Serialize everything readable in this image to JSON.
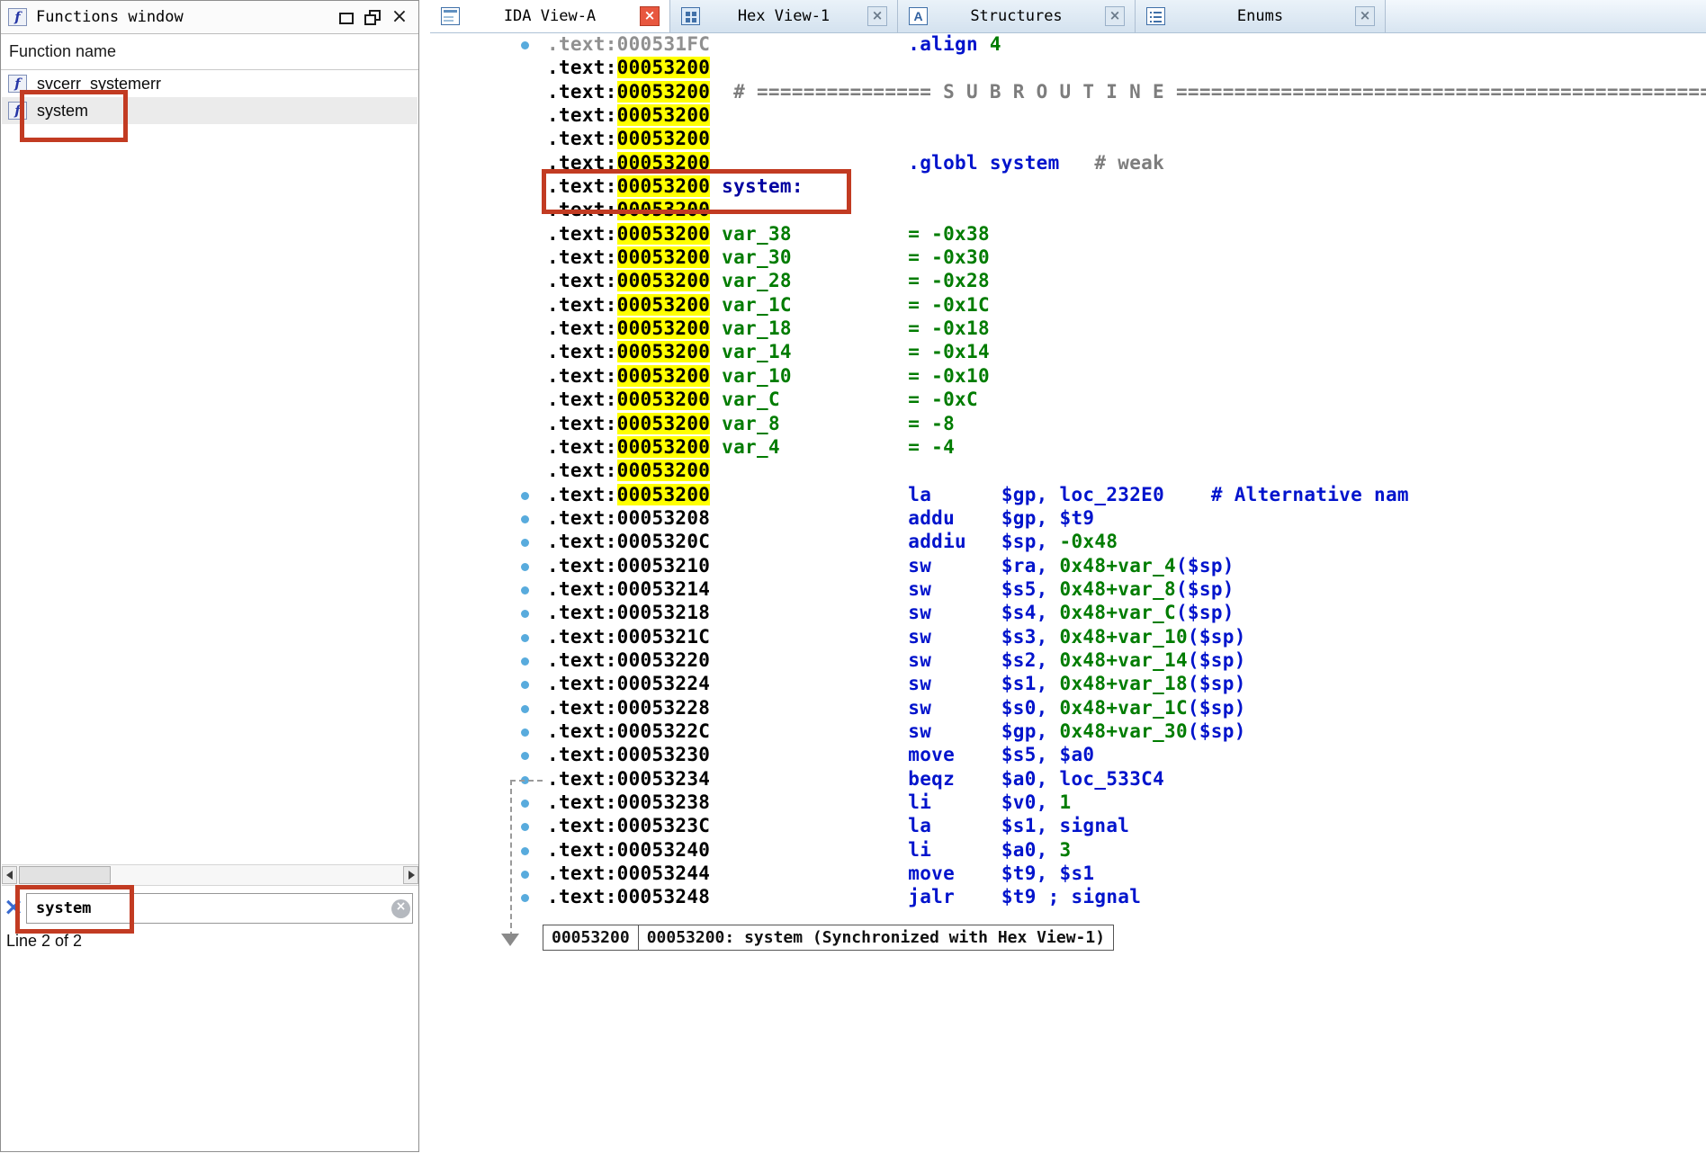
{
  "window": {
    "title": "Functions window"
  },
  "icons": {
    "function_glyph": "f",
    "close_glyph": "×",
    "tab_close_glyph": "×",
    "clear_glyph": "×",
    "filter_glyph": "×"
  },
  "colors": {
    "highlight_yellow": "#ffff00",
    "instruction_blue": "#0013cc",
    "number_green": "#007c00",
    "comment_gray": "#7d7d7d",
    "label_navy": "#0000a0",
    "nav_dot_blue": "#58abdd",
    "annotation_red": "#c23b22",
    "active_close_red": "#e8573f"
  },
  "functions_panel": {
    "column_header": "Function name",
    "rows": [
      {
        "label": "svcerr_systemerr",
        "selected": false
      },
      {
        "label": "system",
        "selected": true
      }
    ],
    "search": {
      "value": "system"
    },
    "status_line": "Line 2 of 2"
  },
  "tab_bar": {
    "tabs": [
      {
        "label": "IDA View-A",
        "icon": "ida-view-icon",
        "active": true
      },
      {
        "label": "Hex View-1",
        "icon": "hex-view-icon",
        "active": false
      },
      {
        "label": "Structures",
        "icon": "structures-icon",
        "active": false
      },
      {
        "label": "Enums",
        "icon": "enums-icon",
        "active": false
      }
    ]
  },
  "disassembly": {
    "status_cells": [
      "00053200",
      "00053200: system (Synchronized with Hex View-1)"
    ],
    "lines": [
      {
        "addr": "000531FC",
        "dim": 1,
        "dot": 1,
        "tokens": [
          [
            "k",
            "                 "
          ],
          [
            "b",
            ".align "
          ],
          [
            "g",
            "4"
          ]
        ]
      },
      {
        "addr": "00053200",
        "hl": 1,
        "tokens": []
      },
      {
        "addr": "00053200",
        "hl": 1,
        "tokens": [
          [
            "c",
            "  # =============== S U B R O U T I N E =============================================================="
          ]
        ]
      },
      {
        "addr": "00053200",
        "hl": 1,
        "tokens": []
      },
      {
        "addr": "00053200",
        "hl": 1,
        "tokens": []
      },
      {
        "addr": "00053200",
        "hl": 1,
        "tokens": [
          [
            "k",
            "                 "
          ],
          [
            "b",
            ".globl system"
          ],
          [
            "k",
            "   "
          ],
          [
            "c",
            "# weak"
          ]
        ]
      },
      {
        "addr": "00053200",
        "hl": 1,
        "tokens": [
          [
            "k",
            " "
          ],
          [
            "nv",
            "system:"
          ]
        ]
      },
      {
        "addr": "00053200",
        "hl": 1,
        "tokens": []
      },
      {
        "addr": "00053200",
        "hl": 1,
        "tokens": [
          [
            "k",
            " "
          ],
          [
            "g",
            "var_38"
          ],
          [
            "k",
            "          "
          ],
          [
            "g",
            "= -0x38"
          ]
        ]
      },
      {
        "addr": "00053200",
        "hl": 1,
        "tokens": [
          [
            "k",
            " "
          ],
          [
            "g",
            "var_30"
          ],
          [
            "k",
            "          "
          ],
          [
            "g",
            "= -0x30"
          ]
        ]
      },
      {
        "addr": "00053200",
        "hl": 1,
        "tokens": [
          [
            "k",
            " "
          ],
          [
            "g",
            "var_28"
          ],
          [
            "k",
            "          "
          ],
          [
            "g",
            "= -0x28"
          ]
        ]
      },
      {
        "addr": "00053200",
        "hl": 1,
        "tokens": [
          [
            "k",
            " "
          ],
          [
            "g",
            "var_1C"
          ],
          [
            "k",
            "          "
          ],
          [
            "g",
            "= -0x1C"
          ]
        ]
      },
      {
        "addr": "00053200",
        "hl": 1,
        "tokens": [
          [
            "k",
            " "
          ],
          [
            "g",
            "var_18"
          ],
          [
            "k",
            "          "
          ],
          [
            "g",
            "= -0x18"
          ]
        ]
      },
      {
        "addr": "00053200",
        "hl": 1,
        "tokens": [
          [
            "k",
            " "
          ],
          [
            "g",
            "var_14"
          ],
          [
            "k",
            "          "
          ],
          [
            "g",
            "= -0x14"
          ]
        ]
      },
      {
        "addr": "00053200",
        "hl": 1,
        "tokens": [
          [
            "k",
            " "
          ],
          [
            "g",
            "var_10"
          ],
          [
            "k",
            "          "
          ],
          [
            "g",
            "= -0x10"
          ]
        ]
      },
      {
        "addr": "00053200",
        "hl": 1,
        "tokens": [
          [
            "k",
            " "
          ],
          [
            "g",
            "var_C"
          ],
          [
            "k",
            "           "
          ],
          [
            "g",
            "= -0xC"
          ]
        ]
      },
      {
        "addr": "00053200",
        "hl": 1,
        "tokens": [
          [
            "k",
            " "
          ],
          [
            "g",
            "var_8"
          ],
          [
            "k",
            "           "
          ],
          [
            "g",
            "= -8"
          ]
        ]
      },
      {
        "addr": "00053200",
        "hl": 1,
        "tokens": [
          [
            "k",
            " "
          ],
          [
            "g",
            "var_4"
          ],
          [
            "k",
            "           "
          ],
          [
            "g",
            "= -4"
          ]
        ]
      },
      {
        "addr": "00053200",
        "hl": 1,
        "tokens": []
      },
      {
        "addr": "00053200",
        "hl": 1,
        "dot": 1,
        "tokens": [
          [
            "k",
            "                 "
          ],
          [
            "b",
            "la"
          ],
          [
            "k",
            "      "
          ],
          [
            "b",
            "$gp, loc_232E0"
          ],
          [
            "k",
            "    "
          ],
          [
            "b",
            "# Alternative nam"
          ]
        ]
      },
      {
        "addr": "00053208",
        "dot": 1,
        "tokens": [
          [
            "k",
            "                 "
          ],
          [
            "b",
            "addu"
          ],
          [
            "k",
            "    "
          ],
          [
            "b",
            "$gp, $t9"
          ]
        ]
      },
      {
        "addr": "0005320C",
        "dot": 1,
        "tokens": [
          [
            "k",
            "                 "
          ],
          [
            "b",
            "addiu"
          ],
          [
            "k",
            "   "
          ],
          [
            "b",
            "$sp, "
          ],
          [
            "g",
            "-0x48"
          ]
        ]
      },
      {
        "addr": "00053210",
        "dot": 1,
        "tokens": [
          [
            "k",
            "                 "
          ],
          [
            "b",
            "sw"
          ],
          [
            "k",
            "      "
          ],
          [
            "b",
            "$ra, "
          ],
          [
            "g",
            "0x48+var_4"
          ],
          [
            "b",
            "($sp)"
          ]
        ]
      },
      {
        "addr": "00053214",
        "dot": 1,
        "tokens": [
          [
            "k",
            "                 "
          ],
          [
            "b",
            "sw"
          ],
          [
            "k",
            "      "
          ],
          [
            "b",
            "$s5, "
          ],
          [
            "g",
            "0x48+var_8"
          ],
          [
            "b",
            "($sp)"
          ]
        ]
      },
      {
        "addr": "00053218",
        "dot": 1,
        "tokens": [
          [
            "k",
            "                 "
          ],
          [
            "b",
            "sw"
          ],
          [
            "k",
            "      "
          ],
          [
            "b",
            "$s4, "
          ],
          [
            "g",
            "0x48+var_C"
          ],
          [
            "b",
            "($sp)"
          ]
        ]
      },
      {
        "addr": "0005321C",
        "dot": 1,
        "tokens": [
          [
            "k",
            "                 "
          ],
          [
            "b",
            "sw"
          ],
          [
            "k",
            "      "
          ],
          [
            "b",
            "$s3, "
          ],
          [
            "g",
            "0x48+var_10"
          ],
          [
            "b",
            "($sp)"
          ]
        ]
      },
      {
        "addr": "00053220",
        "dot": 1,
        "tokens": [
          [
            "k",
            "                 "
          ],
          [
            "b",
            "sw"
          ],
          [
            "k",
            "      "
          ],
          [
            "b",
            "$s2, "
          ],
          [
            "g",
            "0x48+var_14"
          ],
          [
            "b",
            "($sp)"
          ]
        ]
      },
      {
        "addr": "00053224",
        "dot": 1,
        "tokens": [
          [
            "k",
            "                 "
          ],
          [
            "b",
            "sw"
          ],
          [
            "k",
            "      "
          ],
          [
            "b",
            "$s1, "
          ],
          [
            "g",
            "0x48+var_18"
          ],
          [
            "b",
            "($sp)"
          ]
        ]
      },
      {
        "addr": "00053228",
        "dot": 1,
        "tokens": [
          [
            "k",
            "                 "
          ],
          [
            "b",
            "sw"
          ],
          [
            "k",
            "      "
          ],
          [
            "b",
            "$s0, "
          ],
          [
            "g",
            "0x48+var_1C"
          ],
          [
            "b",
            "($sp)"
          ]
        ]
      },
      {
        "addr": "0005322C",
        "dot": 1,
        "tokens": [
          [
            "k",
            "                 "
          ],
          [
            "b",
            "sw"
          ],
          [
            "k",
            "      "
          ],
          [
            "b",
            "$gp, "
          ],
          [
            "g",
            "0x48+var_30"
          ],
          [
            "b",
            "($sp)"
          ]
        ]
      },
      {
        "addr": "00053230",
        "dot": 1,
        "tokens": [
          [
            "k",
            "                 "
          ],
          [
            "b",
            "move"
          ],
          [
            "k",
            "    "
          ],
          [
            "b",
            "$s5, $a0"
          ]
        ]
      },
      {
        "addr": "00053234",
        "dot": 1,
        "tokens": [
          [
            "k",
            "                 "
          ],
          [
            "b",
            "beqz"
          ],
          [
            "k",
            "    "
          ],
          [
            "b",
            "$a0, loc_533C4"
          ]
        ]
      },
      {
        "addr": "00053238",
        "dot": 1,
        "tokens": [
          [
            "k",
            "                 "
          ],
          [
            "b",
            "li"
          ],
          [
            "k",
            "      "
          ],
          [
            "b",
            "$v0, "
          ],
          [
            "g",
            "1"
          ]
        ]
      },
      {
        "addr": "0005323C",
        "dot": 1,
        "tokens": [
          [
            "k",
            "                 "
          ],
          [
            "b",
            "la"
          ],
          [
            "k",
            "      "
          ],
          [
            "b",
            "$s1, signal"
          ]
        ]
      },
      {
        "addr": "00053240",
        "dot": 1,
        "tokens": [
          [
            "k",
            "                 "
          ],
          [
            "b",
            "li"
          ],
          [
            "k",
            "      "
          ],
          [
            "b",
            "$a0, "
          ],
          [
            "g",
            "3"
          ]
        ]
      },
      {
        "addr": "00053244",
        "dot": 1,
        "tokens": [
          [
            "k",
            "                 "
          ],
          [
            "b",
            "move"
          ],
          [
            "k",
            "    "
          ],
          [
            "b",
            "$t9, $s1"
          ]
        ]
      },
      {
        "addr": "00053248",
        "dot": 1,
        "tokens": [
          [
            "k",
            "                 "
          ],
          [
            "b",
            "jalr"
          ],
          [
            "k",
            "    "
          ],
          [
            "b",
            "$t9 "
          ],
          [
            "b",
            "; signal"
          ]
        ]
      }
    ]
  }
}
